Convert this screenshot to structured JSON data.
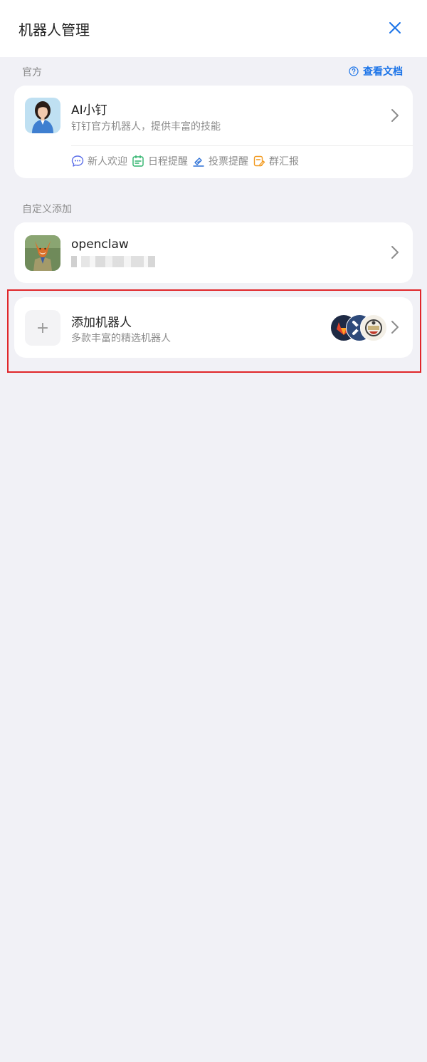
{
  "header": {
    "title": "机器人管理",
    "close_icon": "close-icon"
  },
  "sections": {
    "official_label": "官方",
    "custom_label": "自定义添加"
  },
  "doc_link": {
    "label": "查看文档",
    "icon": "help-circle-icon"
  },
  "official_bot": {
    "name": "AI小钉",
    "description": "钉钉官方机器人，提供丰富的技能",
    "skills": [
      {
        "label": "新人欢迎",
        "icon": "chat-bubble-icon",
        "color": "#5b6ee8"
      },
      {
        "label": "日程提醒",
        "icon": "calendar-icon",
        "color": "#2fb36d"
      },
      {
        "label": "投票提醒",
        "icon": "vote-icon",
        "color": "#2a6fd6"
      },
      {
        "label": "群汇报",
        "icon": "report-icon",
        "color": "#f29a1f"
      }
    ]
  },
  "custom_bot": {
    "name": "openclaw"
  },
  "add_bot": {
    "plus": "+",
    "title": "添加机器人",
    "description": "多款丰富的精选机器人"
  },
  "colors": {
    "accent": "#1a73e8",
    "highlight": "#e0262a",
    "background": "#f1f1f6"
  }
}
